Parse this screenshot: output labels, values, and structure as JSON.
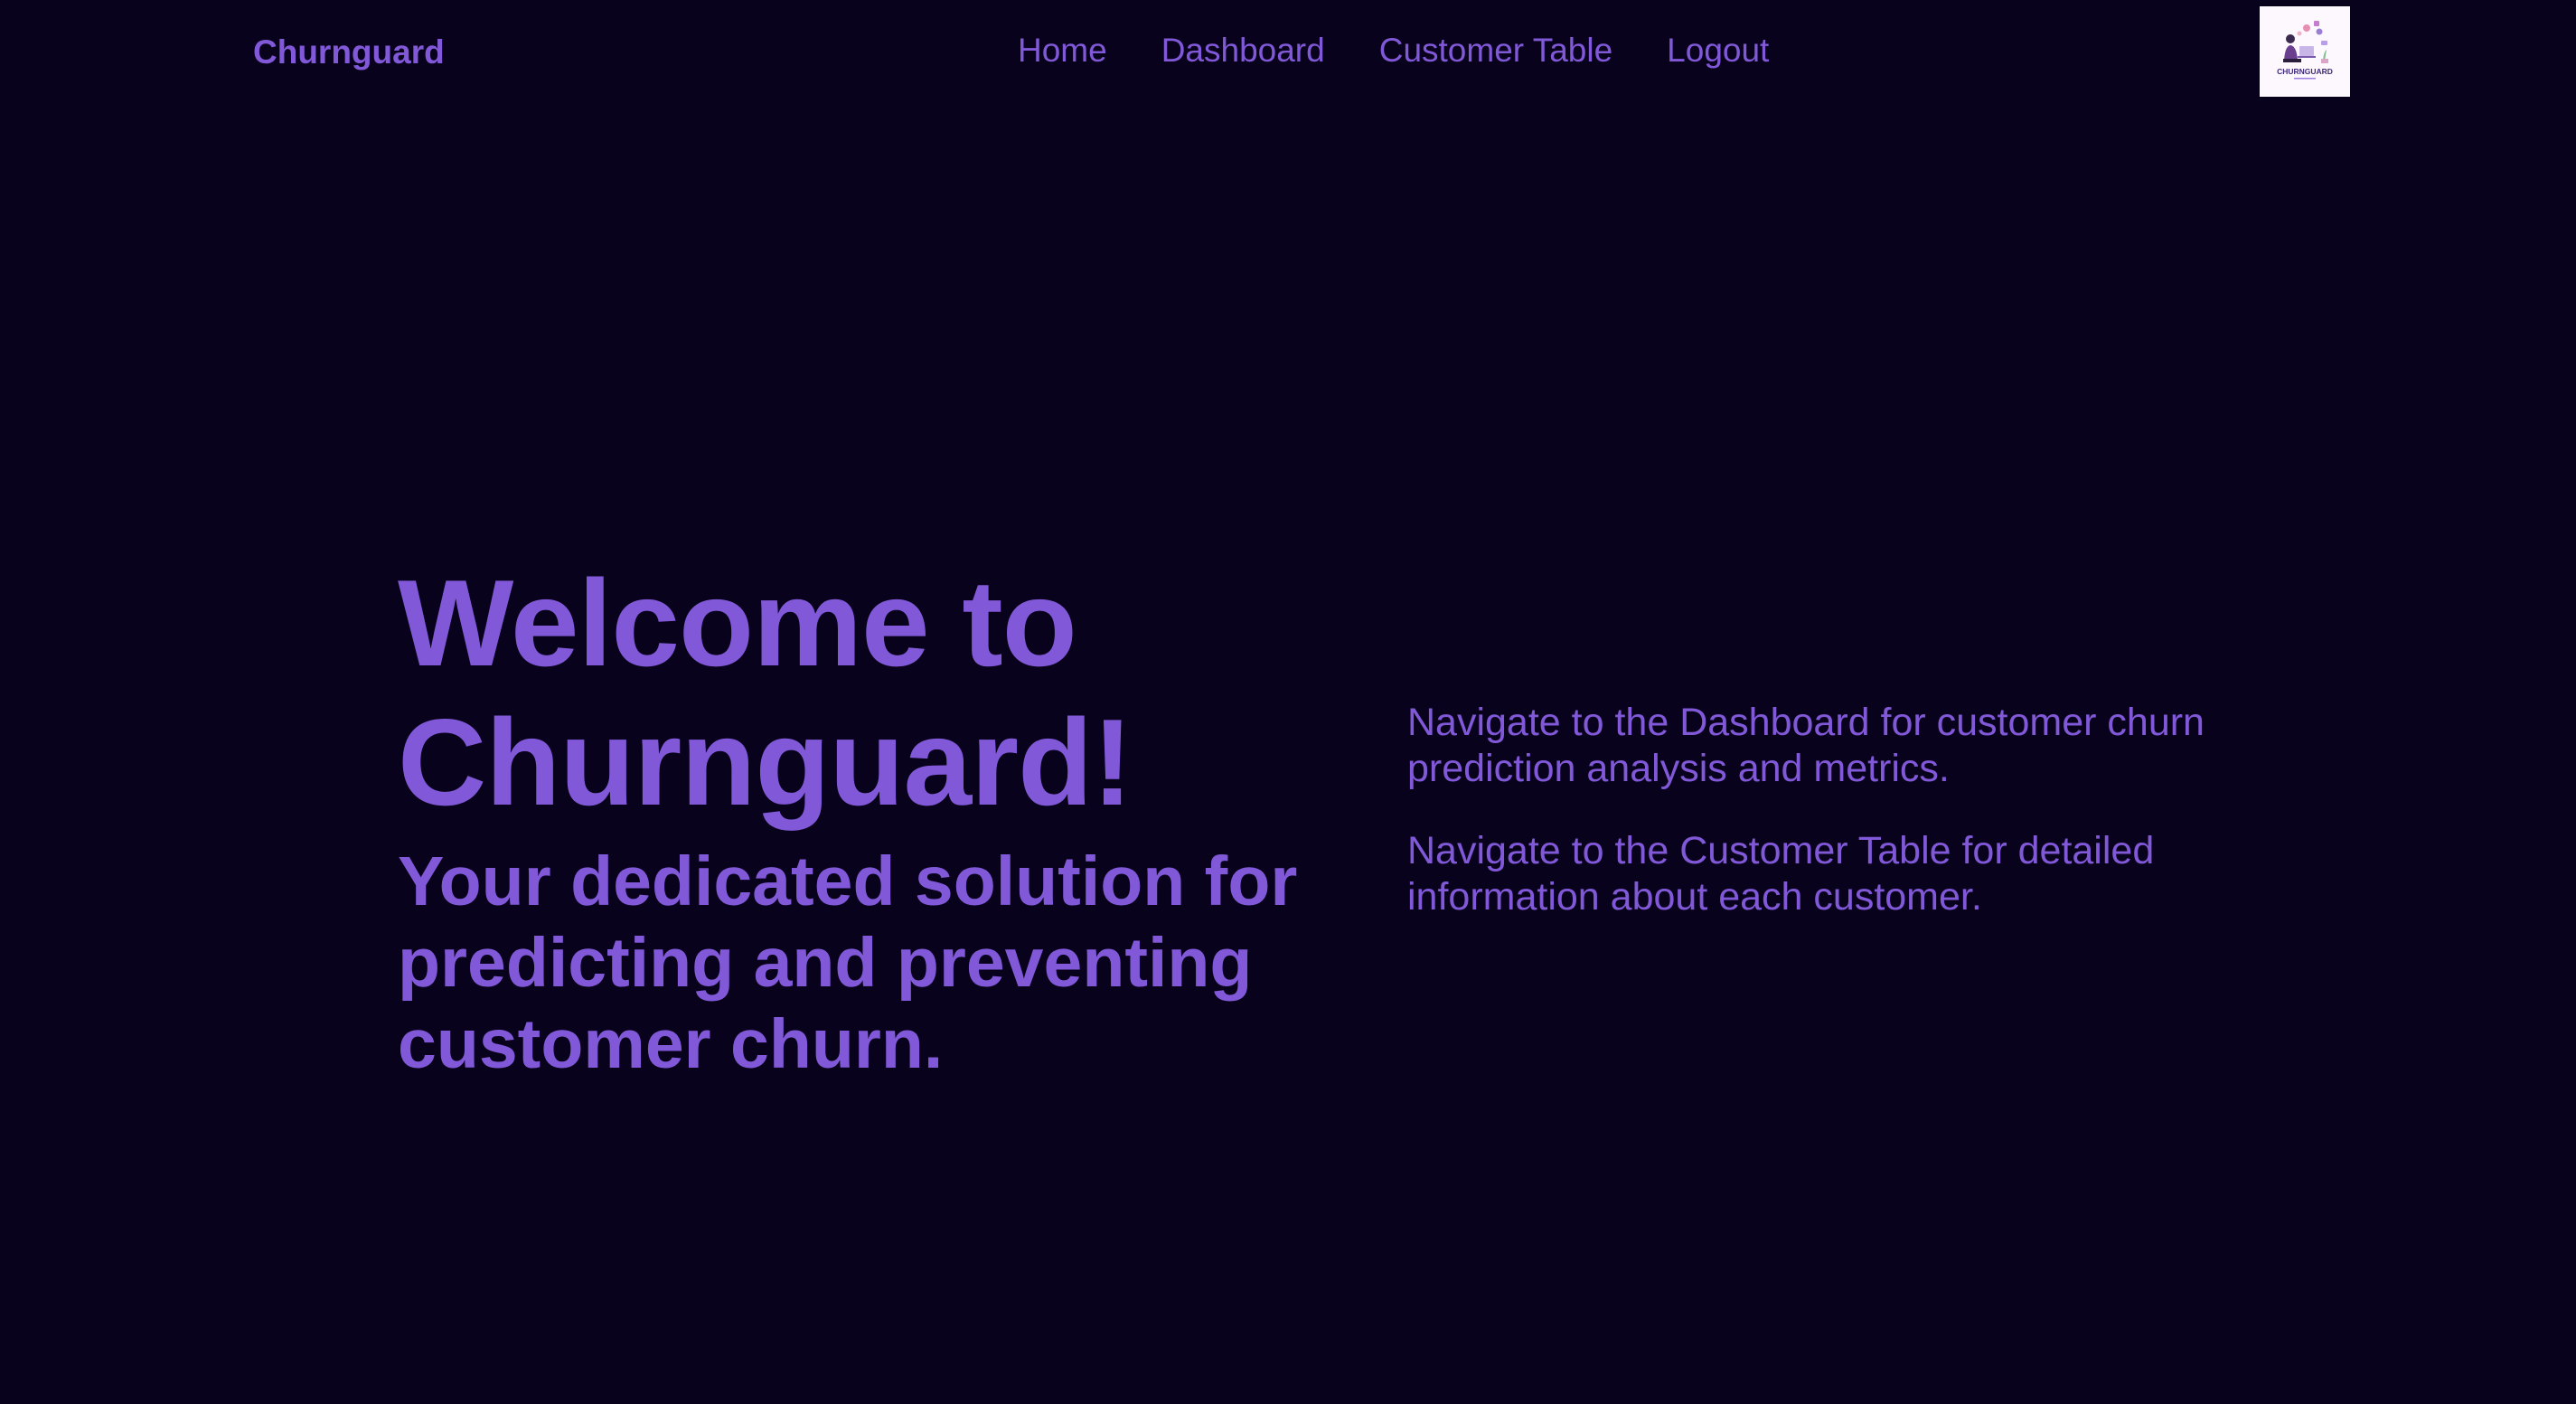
{
  "nav": {
    "brand": "Churnguard",
    "links": [
      {
        "label": "Home"
      },
      {
        "label": "Dashboard"
      },
      {
        "label": "Customer Table"
      },
      {
        "label": "Logout"
      }
    ],
    "logo_text": "CHURNGUARD"
  },
  "hero": {
    "title": "Welcome to Churnguard!",
    "subtitle": "Your dedicated solution for predicting and preventing customer churn.",
    "info": [
      "Navigate to the Dashboard for customer churn prediction analysis and metrics.",
      "Navigate to the Customer Table for detailed information about each customer."
    ]
  },
  "colors": {
    "background": "#08021c",
    "accent": "#8159d8",
    "logo_background": "#ffffff"
  }
}
